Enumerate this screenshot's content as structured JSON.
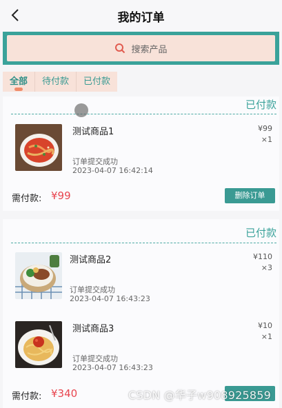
{
  "header": {
    "title": "我的订单",
    "back_icon": "chevron-left-icon"
  },
  "search": {
    "placeholder": "搜索产品",
    "icon": "search-icon"
  },
  "tabs": [
    {
      "label": "全部",
      "active": true
    },
    {
      "label": "待付款",
      "active": false
    },
    {
      "label": "已付款",
      "active": false
    }
  ],
  "orders": [
    {
      "status": "已付款",
      "items": [
        {
          "name": "测试商品1",
          "price": "¥99",
          "qty": "×1",
          "state": "订单提交成功",
          "time": "2023-04-07 16:42:14"
        }
      ],
      "pay_label": "需付款:",
      "pay_amount": "¥99",
      "action_label": "删除订单"
    },
    {
      "status": "已付款",
      "items": [
        {
          "name": "测试商品2",
          "price": "¥110",
          "qty": "×3",
          "state": "订单提交成功",
          "time": "2023-04-07 16:43:23"
        },
        {
          "name": "测试商品3",
          "price": "¥10",
          "qty": "×1",
          "state": "订单提交成功",
          "time": "2023-04-07 16:43:23"
        }
      ],
      "pay_label": "需付款:",
      "pay_amount": "¥340",
      "action_label": ""
    }
  ],
  "watermark": "CSDN @华子w908925859",
  "colors": {
    "accent": "#3aa29a",
    "price": "#e8454f",
    "search_bg": "#f8e2d9"
  }
}
